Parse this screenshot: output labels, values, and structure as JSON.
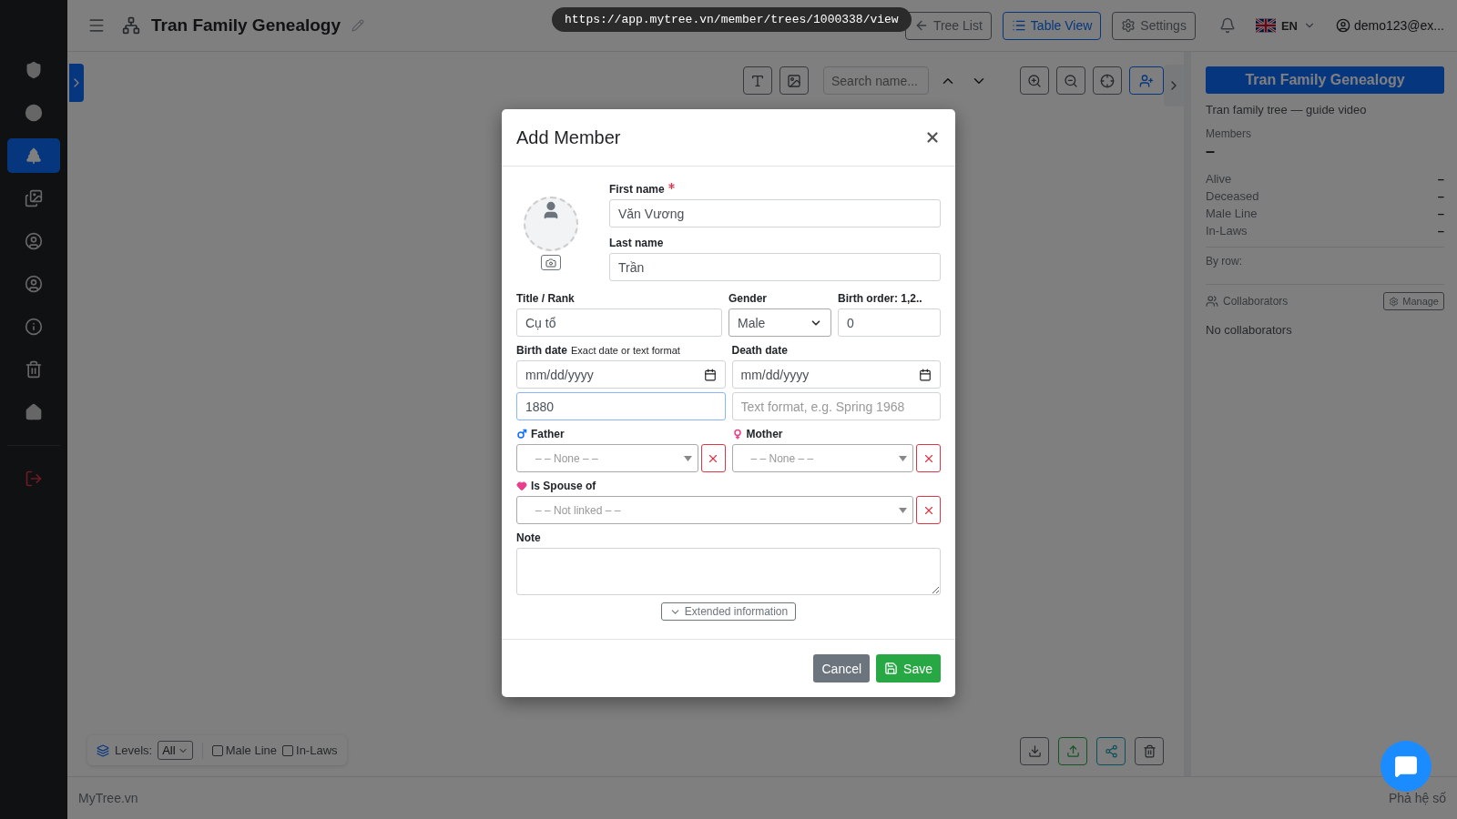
{
  "url_bar": "https://app.mytree.vn/member/trees/1000338/view",
  "header": {
    "title": "Tran Family Genealogy",
    "buttons": [
      {
        "label": "Tree List",
        "kind": "back",
        "selected": false
      },
      {
        "label": "Table View",
        "kind": "list",
        "selected": true
      },
      {
        "label": "Settings",
        "kind": "settings",
        "selected": false
      }
    ],
    "language": "EN",
    "user": "demo123@ex..."
  },
  "sidebar": {
    "items": [
      {
        "kind": "shield",
        "selected": false
      },
      {
        "kind": "circle",
        "selected": false
      },
      {
        "kind": "tree",
        "selected": true
      },
      {
        "kind": "images",
        "selected": false
      },
      {
        "kind": "user",
        "selected": false
      },
      {
        "kind": "user",
        "selected": false
      },
      {
        "kind": "info",
        "selected": false
      },
      {
        "kind": "trash",
        "selected": false
      },
      {
        "kind": "home",
        "selected": false
      },
      {
        "kind": "logout",
        "selected": false
      }
    ]
  },
  "toolbar": {
    "search": {
      "placeholder": "Search name..."
    }
  },
  "bottom_bar": {
    "levels_label": "Levels:",
    "levels_value": "All",
    "filters": [
      {
        "label": "Male Line",
        "checked": false
      },
      {
        "label": "In-Laws",
        "checked": false
      }
    ]
  },
  "side_panel": {
    "title": "Tran Family Genealogy",
    "subtitle": "Tran family tree — guide video",
    "members_label": "Members",
    "members_value": "–",
    "stats": [
      {
        "label": "Alive",
        "value": "–"
      },
      {
        "label": "Deceased",
        "value": "–"
      },
      {
        "label": "Male Line",
        "value": "–"
      },
      {
        "label": "In-Laws",
        "value": "–"
      }
    ],
    "by_row": "By row:",
    "collaborators_label": "Collaborators",
    "manage": "Manage",
    "no_collaborators": "No collaborators"
  },
  "footer": {
    "left": "MyTree.vn",
    "right": "Phả hệ số"
  },
  "modal": {
    "title": "Add Member",
    "first_name": {
      "label": "First name",
      "required": true,
      "value": "Văn Vương"
    },
    "last_name": {
      "label": "Last name",
      "value": "Trần"
    },
    "title_rank": {
      "label": "Title / Rank",
      "value": "Cụ tổ"
    },
    "gender": {
      "label": "Gender",
      "value": "Male"
    },
    "birth_order": {
      "label": "Birth order: 1,2..",
      "value": "0"
    },
    "birth_date": {
      "label": "Birth date",
      "hint": "Exact date or text format",
      "date_placeholder": "mm/dd/yyyy",
      "text_value": "1880",
      "focused": true
    },
    "death_date": {
      "label": "Death date",
      "date_placeholder": "mm/dd/yyyy",
      "text_placeholder": "Text format, e.g. Spring 1968"
    },
    "father": {
      "label": "Father",
      "placeholder": "– – None – –"
    },
    "mother": {
      "label": "Mother",
      "placeholder": "– – None – –"
    },
    "spouse": {
      "label": "Is Spouse of",
      "placeholder": "– – Not linked – –"
    },
    "note": {
      "label": "Note"
    },
    "extended": "Extended information",
    "buttons": [
      {
        "label": "Cancel",
        "kind": "cancel"
      },
      {
        "label": "Save",
        "kind": "save"
      }
    ]
  }
}
